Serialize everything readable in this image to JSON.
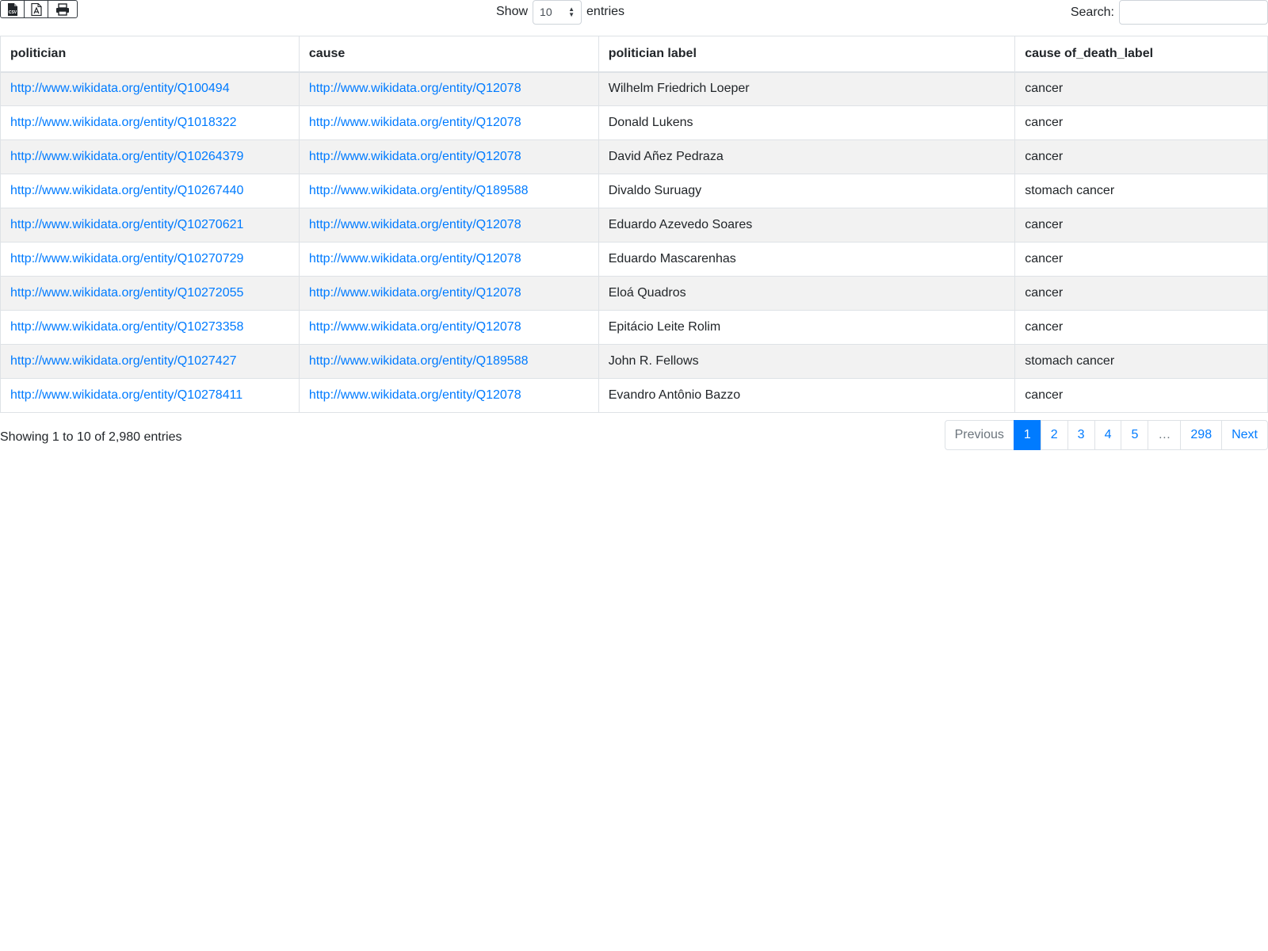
{
  "toolbar": {
    "export_icons": [
      "csv-file-icon",
      "pdf-file-icon",
      "print-icon"
    ],
    "show_label": "Show",
    "length_value": "10",
    "entries_label": "entries",
    "search_label": "Search:",
    "search_value": ""
  },
  "table": {
    "columns": [
      "politician",
      "cause",
      "politician label",
      "cause of_death_label"
    ],
    "rows": [
      [
        "http://www.wikidata.org/entity/Q100494",
        "http://www.wikidata.org/entity/Q12078",
        "Wilhelm Friedrich Loeper",
        "cancer"
      ],
      [
        "http://www.wikidata.org/entity/Q1018322",
        "http://www.wikidata.org/entity/Q12078",
        "Donald Lukens",
        "cancer"
      ],
      [
        "http://www.wikidata.org/entity/Q10264379",
        "http://www.wikidata.org/entity/Q12078",
        "David Añez Pedraza",
        "cancer"
      ],
      [
        "http://www.wikidata.org/entity/Q10267440",
        "http://www.wikidata.org/entity/Q189588",
        "Divaldo Suruagy",
        "stomach cancer"
      ],
      [
        "http://www.wikidata.org/entity/Q10270621",
        "http://www.wikidata.org/entity/Q12078",
        "Eduardo Azevedo Soares",
        "cancer"
      ],
      [
        "http://www.wikidata.org/entity/Q10270729",
        "http://www.wikidata.org/entity/Q12078",
        "Eduardo Mascarenhas",
        "cancer"
      ],
      [
        "http://www.wikidata.org/entity/Q10272055",
        "http://www.wikidata.org/entity/Q12078",
        "Eloá Quadros",
        "cancer"
      ],
      [
        "http://www.wikidata.org/entity/Q10273358",
        "http://www.wikidata.org/entity/Q12078",
        "Epitácio Leite Rolim",
        "cancer"
      ],
      [
        "http://www.wikidata.org/entity/Q1027427",
        "http://www.wikidata.org/entity/Q189588",
        "John R. Fellows",
        "stomach cancer"
      ],
      [
        "http://www.wikidata.org/entity/Q10278411",
        "http://www.wikidata.org/entity/Q12078",
        "Evandro Antônio Bazzo",
        "cancer"
      ]
    ]
  },
  "footer": {
    "info": "Showing 1 to 10 of 2,980 entries",
    "pagination": {
      "previous": "Previous",
      "pages": [
        "1",
        "2",
        "3",
        "4",
        "5",
        "…",
        "298"
      ],
      "active_page": "1",
      "next": "Next"
    }
  },
  "colors": {
    "link": "#007bff",
    "active_page_bg": "#007bff",
    "stripe": "#f2f2f2",
    "border": "#dee2e6"
  }
}
